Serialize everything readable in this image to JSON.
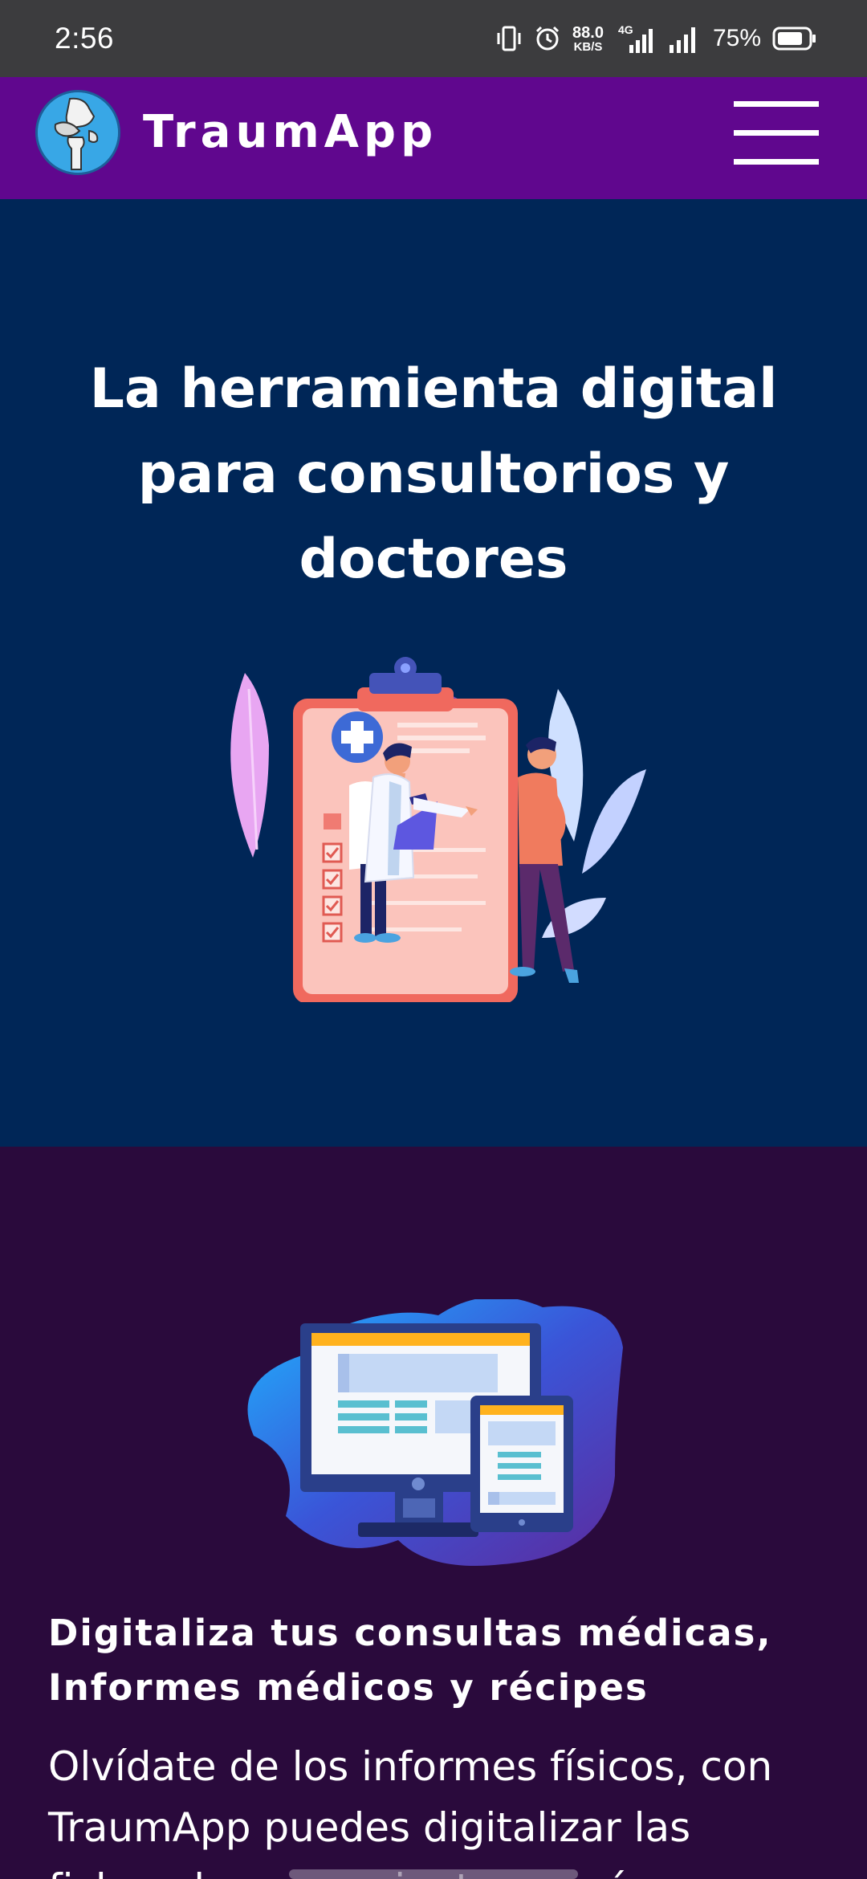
{
  "status_bar": {
    "time": "2:56",
    "net_speed_value": "88.0",
    "net_speed_unit": "KB/S",
    "network_type": "4G",
    "battery_percent": "75%",
    "icons": [
      "vibrate-icon",
      "alarm-icon",
      "signal-4g-icon",
      "signal-icon",
      "battery-icon"
    ]
  },
  "header": {
    "brand": "TraumApp",
    "menu_icon": "hamburger-menu-icon",
    "header_color": "#60078e"
  },
  "hero": {
    "title": "La herramienta digital para consultorios y doctores",
    "background": "#002657",
    "illustration": "doctor-clipboard-illustration"
  },
  "feature": {
    "title_line1": "Digitaliza tus consultas médicas,",
    "title_line2": "Informes médicos y récipes",
    "body_line1": "Olvídate de los informes físicos, con",
    "body_line2": "TraumApp puedes digitalizar las",
    "body_line3": "fichas de sus pacientes y así",
    "background": "#2a0a3c",
    "illustration": "monitor-tablet-illustration"
  }
}
